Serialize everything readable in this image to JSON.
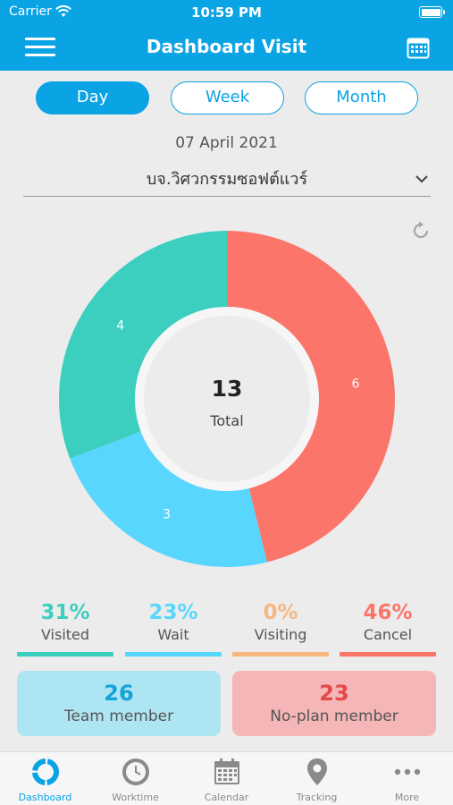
{
  "status_bar": {
    "carrier": "Carrier",
    "time": "10:59 PM"
  },
  "header": {
    "title": "Dashboard Visit"
  },
  "segments": [
    {
      "label": "Day",
      "active": true
    },
    {
      "label": "Week",
      "active": false
    },
    {
      "label": "Month",
      "active": false
    }
  ],
  "date": "07 April 2021",
  "company": {
    "selected": "บจ.วิศวกรรมซอฟต์แวร์"
  },
  "chart_data": {
    "type": "pie",
    "title": "",
    "center_value": "13",
    "center_label": "Total",
    "slices": [
      {
        "name": "Cancel",
        "value": 6,
        "color": "#fc756b"
      },
      {
        "name": "Wait",
        "value": 3,
        "color": "#59d6fe"
      },
      {
        "name": "Visited",
        "value": 4,
        "color": "#3ccfc0"
      }
    ]
  },
  "stats": [
    {
      "pct": "31%",
      "label": "Visited",
      "color": "#3ccfc0"
    },
    {
      "pct": "23%",
      "label": "Wait",
      "color": "#59d6fe"
    },
    {
      "pct": "0%",
      "label": "Visiting",
      "color": "#f8b77e"
    },
    {
      "pct": "46%",
      "label": "Cancel",
      "color": "#fc756b"
    }
  ],
  "cards": {
    "team": {
      "value": "26",
      "label": "Team member",
      "bg": "#aee5f3",
      "color": "#16a2dc"
    },
    "noplan": {
      "value": "23",
      "label": "No-plan member",
      "bg": "#f4b6b6",
      "color": "#e5484a"
    }
  },
  "tabbar": [
    {
      "label": "Dashboard",
      "icon": "dashboard-icon",
      "active": true
    },
    {
      "label": "Worktime",
      "icon": "clock-icon",
      "active": false
    },
    {
      "label": "Calendar",
      "icon": "calendar-icon",
      "active": false
    },
    {
      "label": "Tracking",
      "icon": "map-pin-icon",
      "active": false
    },
    {
      "label": "More",
      "icon": "more-icon",
      "active": false
    }
  ]
}
